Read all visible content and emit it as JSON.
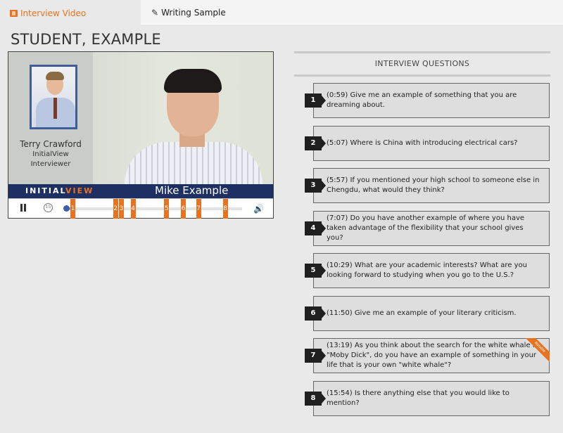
{
  "tabs": [
    {
      "label": "Interview Video",
      "icon": "film-icon",
      "active": true
    },
    {
      "label": "Writing Sample",
      "icon": "pencil-icon",
      "active": false
    }
  ],
  "student": {
    "name": "STUDENT, EXAMPLE"
  },
  "video": {
    "interviewer_name": "Terry Crawford",
    "interviewer_org": "InitialView",
    "interviewer_role": "Interviewer",
    "brand_part1": "INITIAL",
    "brand_part2": "VIEW",
    "interviewee_name": "Mike Example",
    "rewind_label": "15",
    "progress_fraction": 0.03,
    "markers": [
      {
        "label": "1",
        "position": 0.0
      },
      {
        "label": "2",
        "position": 0.255
      },
      {
        "label": "3",
        "position": 0.29
      },
      {
        "label": "4",
        "position": 0.36
      },
      {
        "label": "5",
        "position": 0.56
      },
      {
        "label": "6",
        "position": 0.66
      },
      {
        "label": "7",
        "position": 0.75
      },
      {
        "label": "8",
        "position": 0.91
      }
    ]
  },
  "questions_panel": {
    "title": "INTERVIEW QUESTIONS",
    "questions": [
      {
        "number": "1",
        "time": "(0:59)",
        "text": "Give me an example of something that you are dreaming about."
      },
      {
        "number": "2",
        "time": "(5:07)",
        "text": "Where is China with introducing electrical cars?"
      },
      {
        "number": "3",
        "time": "(5:57)",
        "text": "If you mentioned your high school to someone else in Chengdu, what would they think?"
      },
      {
        "number": "4",
        "time": "(7:07)",
        "text": "Do you have another example of where you have taken advantage of the flexibility that your school gives you?"
      },
      {
        "number": "5",
        "time": "(10:29)",
        "text": "What are your academic interests? What are you looking forward to studying when you go to the U.S.?"
      },
      {
        "number": "6",
        "time": "(11:50)",
        "text": "Give me an example of your literary criticism."
      },
      {
        "number": "7",
        "time": "(13:19)",
        "text": "As you think about the search for the white whale in \"Moby Dick\", do you have an example of something in your life that is your own \"white whale\"?",
        "ribbon": "Notable"
      },
      {
        "number": "8",
        "time": "(15:54)",
        "text": "Is there anything else that you would like to mention?"
      }
    ]
  }
}
